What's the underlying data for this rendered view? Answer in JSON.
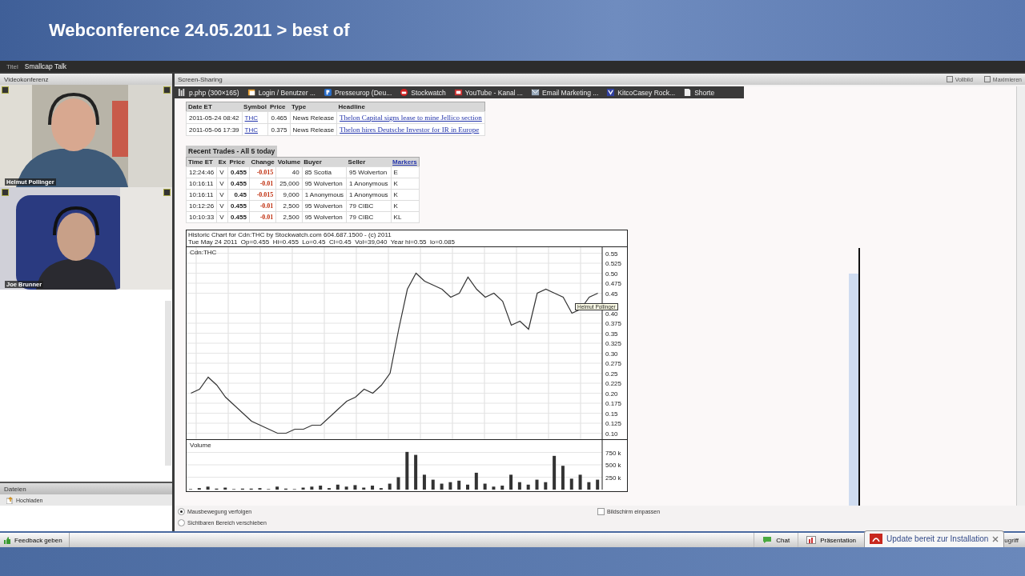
{
  "header": {
    "title": "Webconference 24.05.2011 > best of"
  },
  "title_bar": {
    "label": "Titel",
    "value": "Smallcap Talk"
  },
  "video_panel": {
    "title": "Videokonferenz",
    "participants": [
      {
        "name": "Helmut Pollinger",
        "kind": "picture"
      },
      {
        "name": "Joe Brunner",
        "kind": "picture"
      }
    ]
  },
  "files_panel": {
    "title": "Dateien",
    "items": [
      "Hochladen"
    ]
  },
  "screen_sharing": {
    "title": "Screen-Sharing",
    "actions": [
      "Vollbild",
      "Maximieren"
    ],
    "browser_tabs": [
      "p.php (300×165)",
      "Login / Benutzer ...",
      "Presseurop (Deu...",
      "Stockwatch",
      "YouTube - Kanal ...",
      "Email Marketing ...",
      "KitcoCasey Rock...",
      "Shorte"
    ],
    "bulletins": {
      "columns": [
        "Date ET",
        "Symbol",
        "Price",
        "Type",
        "Headline"
      ],
      "rows": [
        [
          "2011-05-24 08:42",
          "THC",
          "0.465",
          "News Release",
          "Thelon Capital signs lease to mine Jellico section"
        ],
        [
          "2011-05-06 17:39",
          "THC",
          "0.375",
          "News Release",
          "Thelon hires Deutsche Investor for IR in Europe"
        ]
      ]
    },
    "trades": {
      "title": "Recent Trades - All 5 today",
      "columns": [
        "Time ET",
        "Ex",
        "Price",
        "Change",
        "Volume",
        "Buyer",
        "Seller",
        "Markers"
      ],
      "rows": [
        [
          "12:24:46",
          "V",
          "0.455",
          "-0.015",
          "40",
          "85 Scotia",
          "95 Wolverton",
          "E"
        ],
        [
          "10:16:11",
          "V",
          "0.455",
          "-0.01",
          "25,000",
          "95 Wolverton",
          "1 Anonymous",
          "K"
        ],
        [
          "10:16:11",
          "V",
          "0.45",
          "-0.015",
          "9,000",
          "1 Anonymous",
          "1 Anonymous",
          "K"
        ],
        [
          "10:12:26",
          "V",
          "0.455",
          "-0.01",
          "2,500",
          "95 Wolverton",
          "79 CIBC",
          "K"
        ],
        [
          "10:10:33",
          "V",
          "0.455",
          "-0.01",
          "2,500",
          "95 Wolverton",
          "79 CIBC",
          "KL"
        ]
      ]
    },
    "price_chart": {
      "header": [
        "Historic Chart for Cdn:THC by Stockwatch.com 604.687.1500 - (c) 2011",
        "Tue May 24 2011  Op=0.455  Hi=0.455  Lo=0.45  Cl=0.45  Vol=39,040  Year hi=0.55  lo=0.085"
      ],
      "tooltip": "Helmut Pollinger",
      "chart_data": {
        "type": "line",
        "grid": true,
        "ylim": [
          0.085,
          0.565
        ],
        "yticks": [
          {
            "value": 0.55,
            "label": "0.55"
          },
          {
            "value": 0.525,
            "label": "0.525"
          },
          {
            "value": 0.5,
            "label": "0.50"
          },
          {
            "value": 0.475,
            "label": "0.475"
          },
          {
            "value": 0.45,
            "label": "0.45"
          },
          {
            "value": 0.4,
            "label": "0.40"
          },
          {
            "value": 0.375,
            "label": "0.375"
          },
          {
            "value": 0.35,
            "label": "0.35"
          },
          {
            "value": 0.325,
            "label": "0.325"
          },
          {
            "value": 0.3,
            "label": "0.30"
          },
          {
            "value": 0.275,
            "label": "0.275"
          },
          {
            "value": 0.25,
            "label": "0.25"
          },
          {
            "value": 0.225,
            "label": "0.225"
          },
          {
            "value": 0.2,
            "label": "0.20"
          },
          {
            "value": 0.175,
            "label": "0.175"
          },
          {
            "value": 0.15,
            "label": "0.15"
          },
          {
            "value": 0.125,
            "label": "0.125"
          },
          {
            "value": 0.1,
            "label": "0.10"
          }
        ],
        "series": [
          {
            "name": "Cdn:THC",
            "color": "#333333",
            "values": [
              0.2,
              0.21,
              0.24,
              0.22,
              0.19,
              0.17,
              0.15,
              0.13,
              0.12,
              0.11,
              0.1,
              0.1,
              0.11,
              0.11,
              0.12,
              0.12,
              0.14,
              0.16,
              0.18,
              0.19,
              0.21,
              0.2,
              0.22,
              0.25,
              0.36,
              0.46,
              0.5,
              0.48,
              0.47,
              0.46,
              0.44,
              0.45,
              0.49,
              0.46,
              0.44,
              0.45,
              0.43,
              0.37,
              0.38,
              0.36,
              0.45,
              0.46,
              0.45,
              0.44,
              0.4,
              0.41,
              0.44,
              0.45
            ]
          }
        ]
      }
    },
    "volume_chart": {
      "label": "Volume",
      "chart_data": {
        "type": "bar",
        "grid": true,
        "ylim": [
          0,
          1000
        ],
        "yticks": [
          {
            "value": 750,
            "label": "750 k"
          },
          {
            "value": 500,
            "label": "500 k"
          },
          {
            "value": 250,
            "label": "250 k"
          }
        ],
        "values": [
          10,
          30,
          60,
          20,
          40,
          10,
          20,
          20,
          30,
          10,
          60,
          20,
          10,
          40,
          60,
          80,
          30,
          100,
          60,
          90,
          40,
          80,
          30,
          120,
          250,
          760,
          700,
          300,
          200,
          120,
          150,
          180,
          100,
          340,
          120,
          60,
          80,
          300,
          150,
          100,
          200,
          150,
          680,
          480,
          220,
          300,
          150,
          200
        ]
      }
    },
    "options": [
      {
        "kind": "radio",
        "label": "Mausbewegung verfolgen",
        "selected": true
      },
      {
        "kind": "radio",
        "label": "Sichtbaren Bereich verschieben",
        "selected": false
      }
    ],
    "fit_screen": {
      "label": "Bildschirm einpassen",
      "checked": false
    }
  },
  "status_bar": {
    "feedback": "Feedback geben",
    "buttons": [
      "Chat",
      "Präsentation"
    ],
    "notification": "Update bereit zur Installation",
    "cut_text": "ugriff"
  }
}
